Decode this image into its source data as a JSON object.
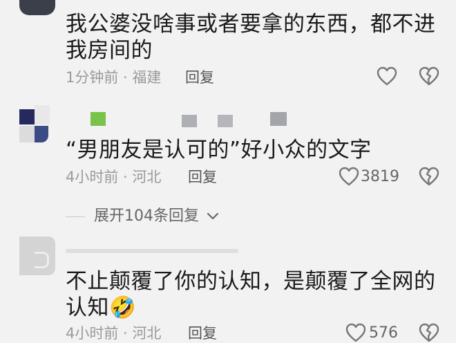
{
  "comments": [
    {
      "text_line1": "我公婆没啥事或者要拿的东西，都不进",
      "text_line2": "我房间的",
      "meta": "1分钟前 · 福建",
      "reply_label": "回复",
      "like_count": ""
    },
    {
      "text": "“男朋友是认可的”好小众的文字",
      "meta": "4小时前 · 河北",
      "reply_label": "回复",
      "like_count": "3819"
    },
    {
      "text_line1": "不止颠覆了你的认知，是颠覆了全网的",
      "text_line2": "认知",
      "emoji": "🤣",
      "meta": "4小时前 · 河北",
      "reply_label": "回复",
      "like_count": "576"
    }
  ],
  "expand_replies": {
    "label": "展开104条回复"
  },
  "colors": {
    "background": "#f2f2f2",
    "text": "#1a1a1a",
    "meta": "#9a9a9a"
  }
}
